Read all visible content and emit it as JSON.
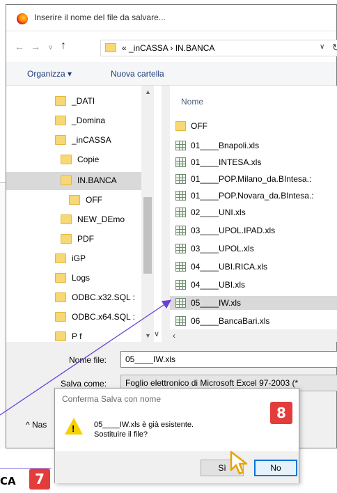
{
  "window": {
    "title": "Inserire il nome del file da salvare..."
  },
  "address": {
    "path": "«  _inCASSA  ›  IN.BANCA"
  },
  "toolbar": {
    "organizza": "Organizza ▾",
    "nuova_cartella": "Nuova cartella"
  },
  "nav_tree": [
    {
      "label": "_DATI"
    },
    {
      "label": "_Domina"
    },
    {
      "label": "_inCASSA"
    },
    {
      "label": "Copie"
    },
    {
      "label": "IN.BANCA"
    },
    {
      "label": "OFF"
    },
    {
      "label": "NEW_DEmo"
    },
    {
      "label": "PDF"
    },
    {
      "label": "iGP"
    },
    {
      "label": "Logs"
    },
    {
      "label": "ODBC.x32.SQL :"
    },
    {
      "label": "ODBC.x64.SQL :"
    },
    {
      "label": "P   f"
    }
  ],
  "files": {
    "column_header": "Nome",
    "items": [
      {
        "name": "OFF",
        "type": "folder"
      },
      {
        "name": "01____Bnapoli.xls",
        "type": "xls"
      },
      {
        "name": "01____INTESA.xls",
        "type": "xls"
      },
      {
        "name": "01____POP.Milano_da.BIntesa.:",
        "type": "xls"
      },
      {
        "name": "01____POP.Novara_da.BIntesa.:",
        "type": "xls"
      },
      {
        "name": "02____UNI.xls",
        "type": "xls"
      },
      {
        "name": "03____UPOL.IPAD.xls",
        "type": "xls"
      },
      {
        "name": "03____UPOL.xls",
        "type": "xls"
      },
      {
        "name": "04____UBI.RICA.xls",
        "type": "xls"
      },
      {
        "name": "04____UBI.xls",
        "type": "xls"
      },
      {
        "name": "05____IW.xls",
        "type": "xls",
        "selected": true
      },
      {
        "name": "06____BancaBari.xls",
        "type": "xls"
      }
    ]
  },
  "form": {
    "nome_file_label": "Nome file:",
    "nome_file_value": "05____IW.xls",
    "salva_come_label": "Salva come:",
    "salva_come_value": "Foglio elettronico di Microsoft Excel 97-2003 (*",
    "nascondi_label": "^  Nas"
  },
  "confirm_dialog": {
    "title": "Conferma Salva con nome",
    "message_line1": "05____IW.xls è già esistente.",
    "message_line2": "Sostituire il file?",
    "yes_label": "Sì",
    "no_label": "No"
  },
  "badges": {
    "step8": "8",
    "step7": "7",
    "fragment_text": "CA",
    "color": "#e43b3b"
  },
  "annotation": {
    "arrow_color": "#6a3fd8"
  }
}
